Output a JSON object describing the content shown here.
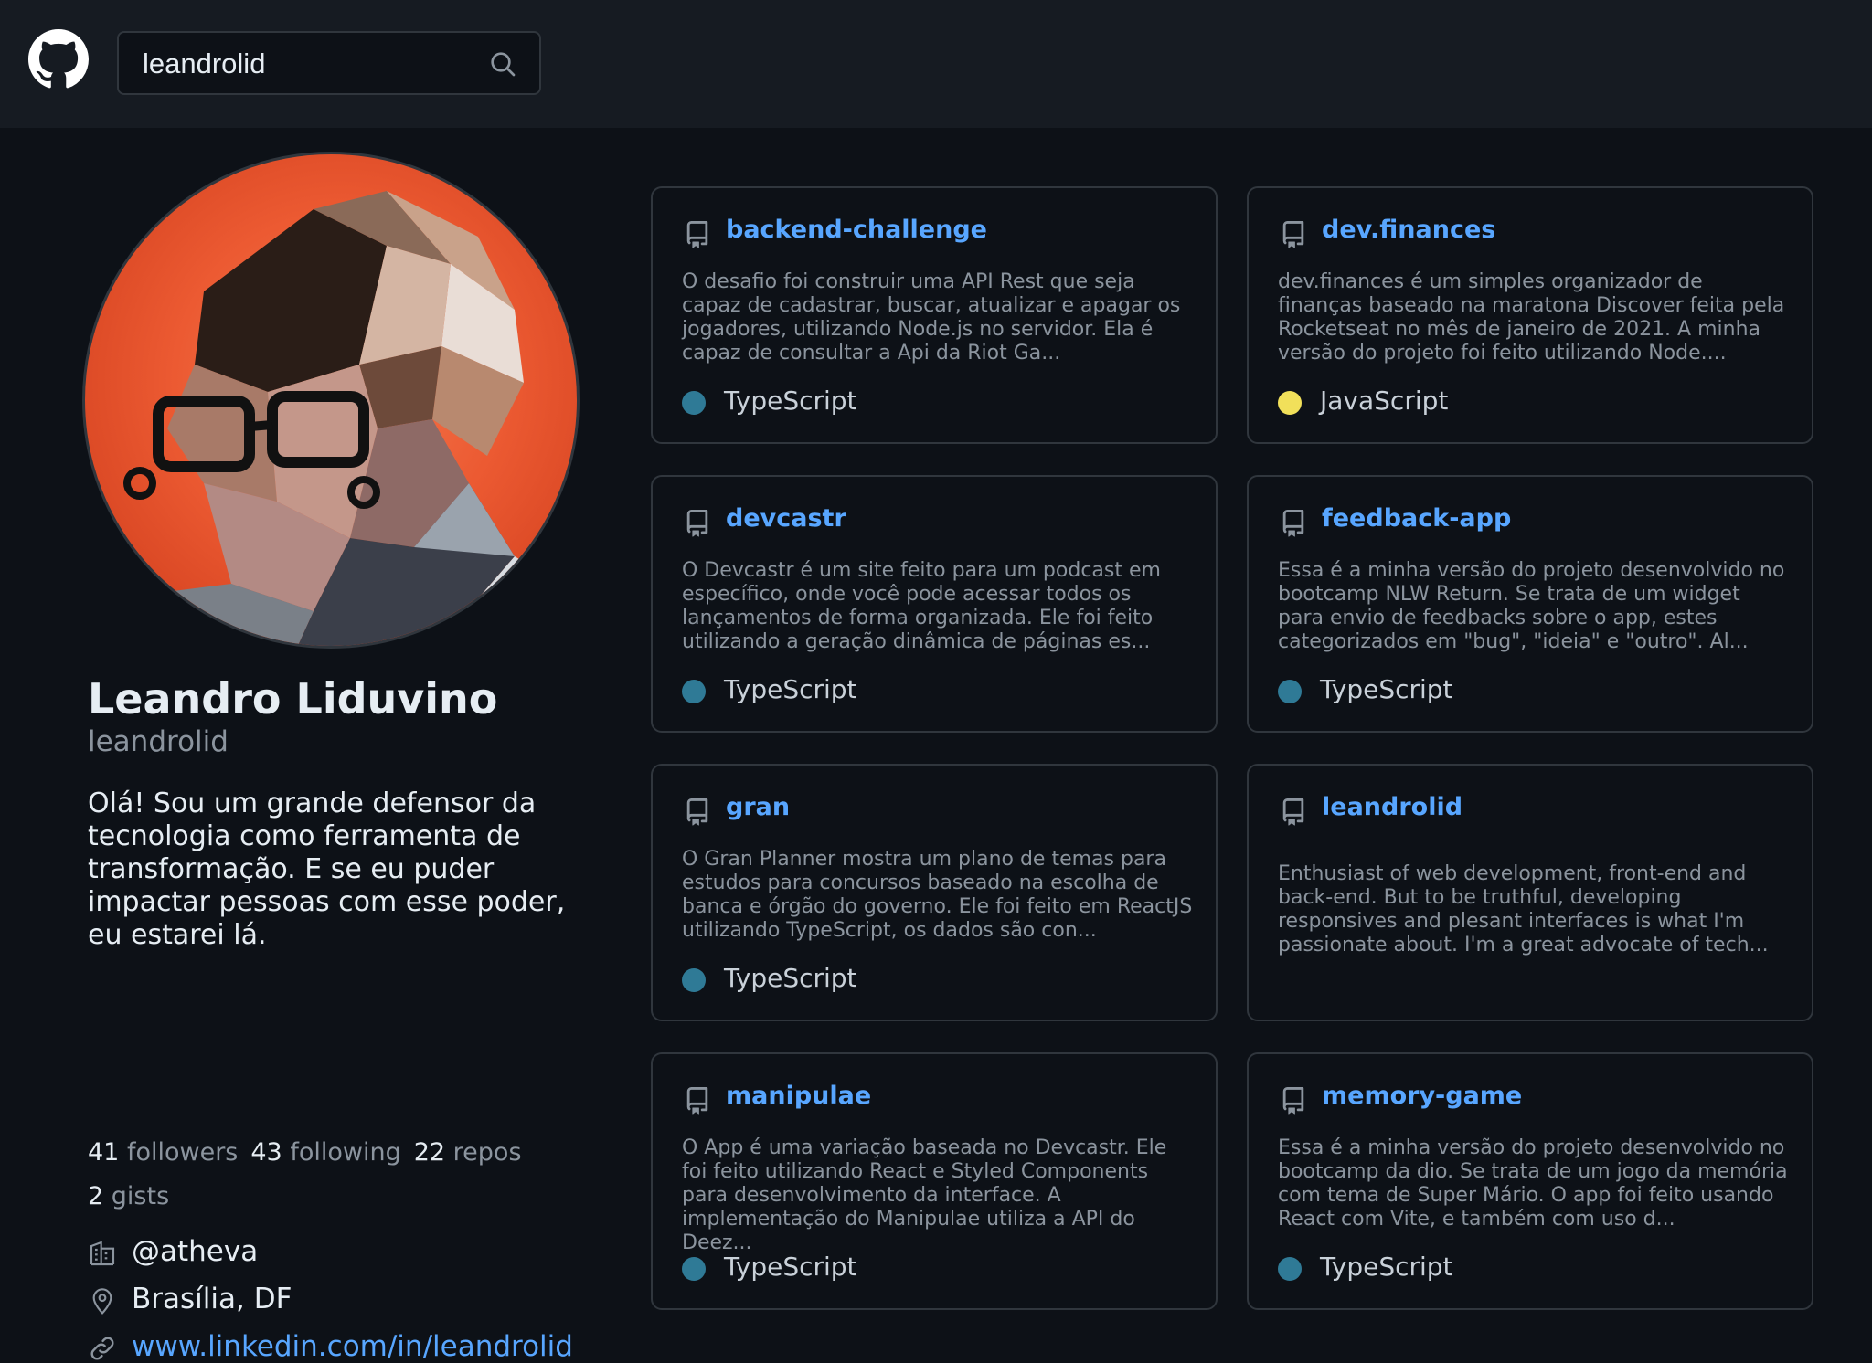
{
  "header": {
    "search": {
      "value": "leandrolid",
      "placeholder": ""
    }
  },
  "profile": {
    "name": "Leandro Liduvino",
    "login": "leandrolid",
    "bio": "Olá! Sou um grande defensor da tecnologia como ferramenta de transformação. E se eu puder impactar pessoas com esse poder, eu estarei lá.",
    "stats": [
      {
        "count": "41",
        "label": "followers"
      },
      {
        "count": "43",
        "label": "following"
      },
      {
        "count": "22",
        "label": "repos"
      },
      {
        "count": "2",
        "label": "gists"
      }
    ],
    "company": "@atheva",
    "location": "Brasília, DF",
    "blog": "www.linkedin.com/in/leandrolid"
  },
  "repos": [
    {
      "name": "backend-challenge",
      "description": "O desafio foi construir uma API Rest que seja capaz de cadastrar, buscar, atualizar e apagar os jogadores, utilizando Node.js no servidor. Ela é capaz de consultar a Api da Riot Ga...",
      "language": "TypeScript",
      "language_color": "#2f7a96"
    },
    {
      "name": "dev.finances",
      "description": "dev.finances é um simples organizador de finanças baseado na maratona Discover feita pela Rocketseat no mês de janeiro de 2021. A minha versão do projeto foi feito utilizando Node....",
      "language": "JavaScript",
      "language_color": "#f1e05a"
    },
    {
      "name": "devcastr",
      "description": "O Devcastr é um site feito para um podcast em específico, onde você pode acessar todos os lançamentos de forma organizada. Ele foi feito utilizando a geração dinâmica de páginas es...",
      "language": "TypeScript",
      "language_color": "#2f7a96"
    },
    {
      "name": "feedback-app",
      "description": "Essa é a minha versão do projeto desenvolvido no bootcamp NLW Return. Se trata de um widget para envio de feedbacks sobre o app, estes categorizados em \"bug\", \"ideia\" e \"outro\". Al...",
      "language": "TypeScript",
      "language_color": "#2f7a96"
    },
    {
      "name": "gran",
      "description": "O Gran Planner mostra um plano de temas para estudos para concursos baseado na escolha de banca e órgão do governo. Ele foi feito em ReactJS utilizando TypeScript, os dados são con...",
      "language": "TypeScript",
      "language_color": "#2f7a96"
    },
    {
      "name": "leandrolid",
      "description": "Enthusiast of web development, front-end and back-end. But to be truthful, developing responsives and plesant interfaces is what I'm passionate about. I'm a great advocate of tech...",
      "language": "",
      "language_color": ""
    },
    {
      "name": "manipulae",
      "description": "O App é uma variação baseada no Devcastr. Ele foi feito utilizando React e Styled Components para desenvolvimento da interface. A implementação do Manipulae utiliza a API do Deez...",
      "language": "TypeScript",
      "language_color": "#2f7a96"
    },
    {
      "name": "memory-game",
      "description": "Essa é a minha versão do projeto desenvolvido no bootcamp da dio. Se trata de um jogo da memória com tema de Super Mário. O app foi feito usando React com Vite, e também com uso d...",
      "language": "TypeScript",
      "language_color": "#2f7a96"
    }
  ]
}
